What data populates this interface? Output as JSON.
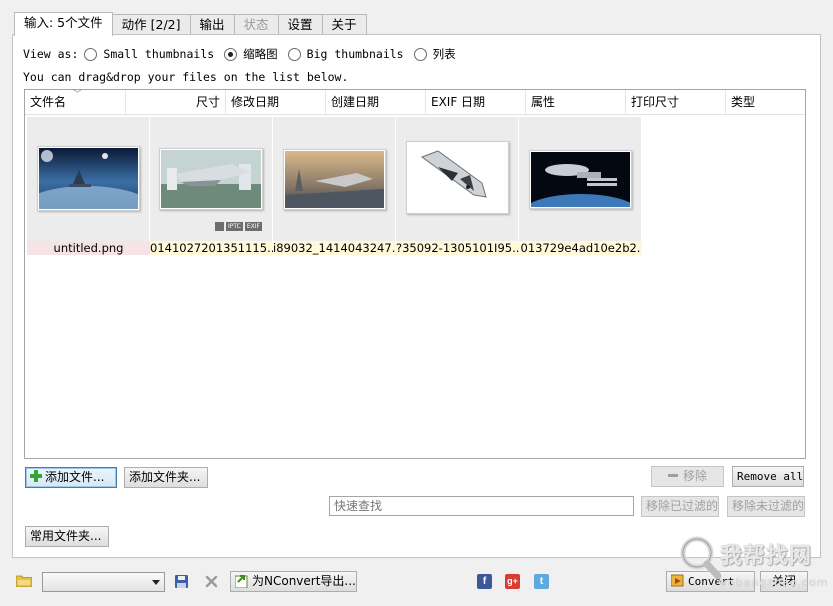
{
  "tabs": [
    {
      "label": "输入: 5个文件",
      "active": true
    },
    {
      "label": "动作 [2/2]"
    },
    {
      "label": "输出"
    },
    {
      "label": "状态",
      "disabled": true
    },
    {
      "label": "设置"
    },
    {
      "label": "关于"
    }
  ],
  "view": {
    "label": "View as:",
    "options": [
      "Small thumbnails",
      "缩略图",
      "Big thumbnails",
      "列表"
    ],
    "selected": "缩略图",
    "hint": "You can drag&drop your files on the list below."
  },
  "columns": [
    "文件名",
    "尺寸",
    "修改日期",
    "创建日期",
    "EXIF 日期",
    "属性",
    "打印尺寸",
    "类型"
  ],
  "files": [
    {
      "name": "untitled.png",
      "selected": true
    },
    {
      "name": "0141027201351115..",
      "badges": [
        "",
        "IPTC",
        "EXIF"
      ]
    },
    {
      "name": "i89032_1414043247..."
    },
    {
      "name": "?35092-1305101I95.."
    },
    {
      "name": "013729e4ad10e2b2."
    }
  ],
  "buttons": {
    "add_files": "添加文件...",
    "add_folder": "添加文件夹...",
    "remove": "移除",
    "remove_all": "Remove all",
    "remove_filtered": "移除已过滤的",
    "remove_unfiltered": "移除未过滤的",
    "common_folders": "常用文件夹...",
    "export_nconvert": "为NConvert导出...",
    "convert": "Convert",
    "close": "关闭"
  },
  "search": {
    "placeholder": "快速查找",
    "value": ""
  },
  "watermark": {
    "text": "我帮找网",
    "sub": "wobangzhao.com"
  },
  "icons": {
    "folder": "folder-icon",
    "save": "save-icon",
    "delete": "delete-icon",
    "export": "export-icon",
    "facebook": "facebook-icon",
    "googleplus": "google-plus-icon",
    "twitter": "twitter-icon",
    "convert": "convert-icon"
  },
  "colors": {
    "selected_name_bg": "#f6e3e6",
    "name_bg": "#fff8d9",
    "focus_border": "#3c7fb1"
  }
}
